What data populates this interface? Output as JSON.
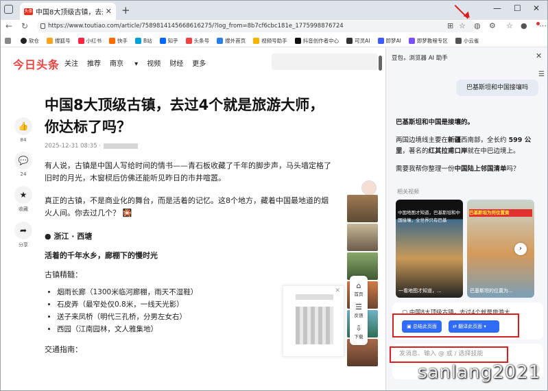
{
  "browser": {
    "tab_title": "中国8大顶级古镇，去过4个就是旅游大师，你达标了吗？",
    "tab_favicon_text": "头条",
    "url": "https://www.toutiao.com/article/7589814145668616275/?log_from=8b7cf6cbc181e_1775998876724"
  },
  "bookmarks": [
    "软仓",
    "搜狐号",
    "小红书",
    "快手",
    "B站",
    "知乎",
    "头条号",
    "搜外首页",
    "视频号助手",
    "抖音创作者中心",
    "可灵AI",
    "即梦AI",
    "即梦教程专区",
    "小云雀"
  ],
  "site": {
    "logo": "今日头条",
    "nav": [
      "关注",
      "推荐",
      "南京",
      "视频",
      "财经",
      "更多"
    ]
  },
  "actions": [
    {
      "label": "84"
    },
    {
      "label": "24"
    },
    {
      "label": "收藏"
    },
    {
      "label": "分享"
    }
  ],
  "article": {
    "title": "中国8大顶级古镇，去过4个就是旅游大师，你达标了吗？",
    "date": "2025-12-31 08:35 ·",
    "p1": "有人说，古镇是中国人写给时间的情书——青石板收藏了千年的脚步声，马头墙定格了旧时的月光，木窗棂后仿佛还能听见昨日的市井喧嚣。",
    "p2": "真正的古镇，不是商业化的舞台，而是活着的记忆。这8个地方，藏着中国最地道的烟火人间。你去过几个？",
    "section": "浙江 · 西塘",
    "subtitle": "活着的千年水乡，廊棚下的慢时光",
    "jing": "古镇精髓：",
    "list": [
      "烟雨长廊（1300米临河廊棚，雨天不湿鞋）",
      "石皮弄（最窄处仅0.8米，一线天光影）",
      "送子来凤桥（明代三孔桥，分男左女右）",
      "西园（江南园林，文人雅集地）"
    ],
    "traffic": "交通指南："
  },
  "float": {
    "home": "首页",
    "feedback": "反馈",
    "download": "下载"
  },
  "panel": {
    "header": "豆包，浏览器 AI 助手",
    "question": "巴基斯坦和中国接壤吗",
    "ans_head": "巴基斯坦和中国是接壤的。",
    "ans_p1_a": "两国边境线主要在",
    "ans_p1_b": "新疆",
    "ans_p1_c": "西南部，全长约 ",
    "ans_p1_d": "599 公里",
    "ans_p1_e": "，著名的",
    "ans_p1_f": "红其拉甫口岸",
    "ans_p1_g": "就在中巴边境上。",
    "ans_p2_a": "需要我帮你整理一份",
    "ans_p2_b": "中国陆上邻国清单",
    "ans_p2_c": "吗？",
    "related": "相关视频",
    "video1_overlay": "中国地图才知道，巴基斯坦和中国接壤，全世界只有巴基",
    "video1_caption": "一看地图才知道，...",
    "video2_overlay": "巴基斯坦为何位置竟",
    "video2_caption": "巴基斯坦的位置为...",
    "page_title": "中国8大顶级古镇，去过4个就是旅游大...",
    "btn_summary": "总结此页面",
    "btn_translate": "翻译此页面",
    "input_placeholder": "发消息、输入 @ 或 / 选择技能"
  },
  "watermark": "sanlang2021"
}
